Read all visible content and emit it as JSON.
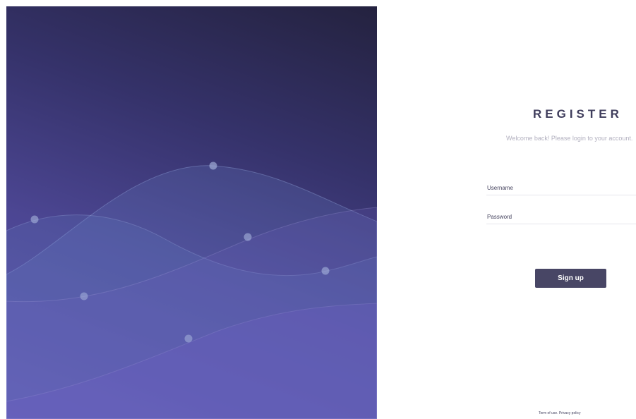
{
  "register": {
    "title": "REGISTER",
    "subtitle": "Welcome back! Please login to your account."
  },
  "form": {
    "username_placeholder": "Username",
    "password_placeholder": "Password",
    "signup_label": "Sign up"
  },
  "footer": {
    "terms_label": "Term of use.",
    "privacy_label": "Privacy policy"
  },
  "colors": {
    "hero_dark": "#24223f",
    "hero_mid": "#4c4693",
    "hero_light": "#6154b0",
    "title_text": "#3f3d5c",
    "subtitle_text": "#b2b0bf",
    "button_bg": "#484665"
  }
}
